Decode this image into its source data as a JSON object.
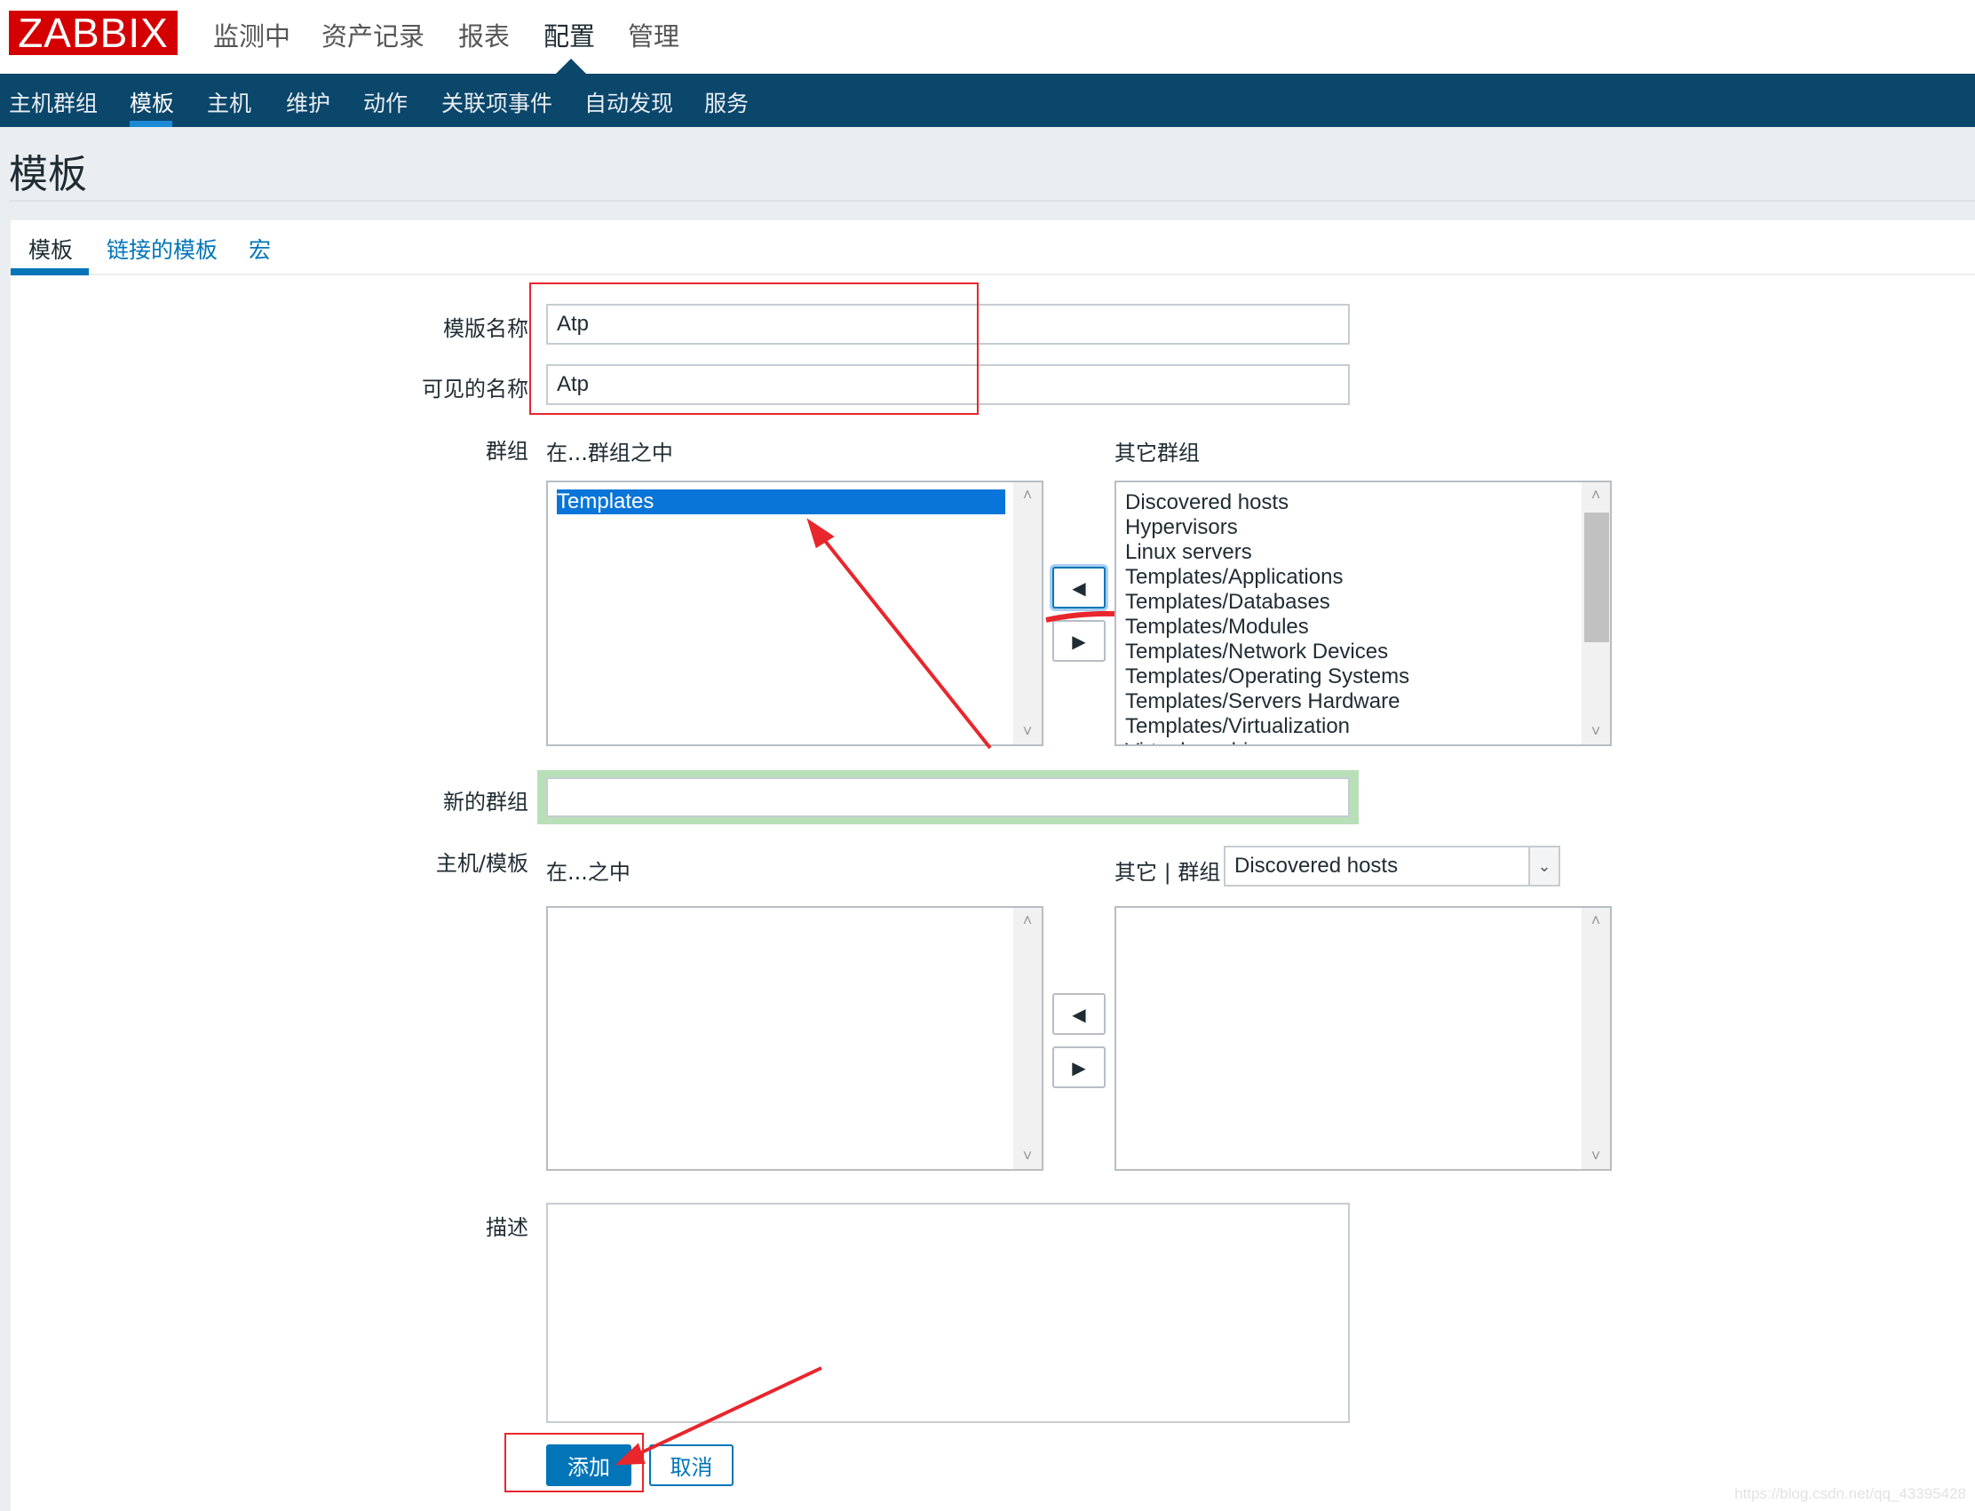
{
  "logo": "ZABBIX",
  "top_menu": [
    "监测中",
    "资产记录",
    "报表",
    "配置",
    "管理"
  ],
  "top_menu_active": "配置",
  "sub_menu": [
    "主机群组",
    "模板",
    "主机",
    "维护",
    "动作",
    "关联项事件",
    "自动发现",
    "服务"
  ],
  "sub_menu_active": "模板",
  "page_title": "模板",
  "tabs": [
    "模板",
    "链接的模板",
    "宏"
  ],
  "form": {
    "template_name_label": "模版名称",
    "template_name_value": "Atp",
    "visible_name_label": "可见的名称",
    "visible_name_value": "Atp",
    "groups_label": "群组",
    "in_groups_label": "在...群组之中",
    "other_groups_label": "其它群组",
    "in_groups": [
      "Templates"
    ],
    "other_groups": [
      "Discovered hosts",
      "Hypervisors",
      "Linux servers",
      "Templates/Applications",
      "Templates/Databases",
      "Templates/Modules",
      "Templates/Network Devices",
      "Templates/Operating Systems",
      "Templates/Servers Hardware",
      "Templates/Virtualization",
      "Virtual machines"
    ],
    "new_group_label": "新的群组",
    "new_group_value": "",
    "hosts_label": "主机/模板",
    "in_label": "在...之中",
    "other_group_label": "其它 | 群组",
    "group_select_value": "Discovered hosts",
    "description_label": "描述",
    "description_value": "",
    "add_button": "添加",
    "cancel_button": "取消"
  },
  "watermark": "https://blog.csdn.net/qq_43395428",
  "colors": {
    "brand": "#d40000",
    "nav": "#0b466b",
    "accent": "#0275b8",
    "annotation": "#e8262c",
    "highlight": "#b9dfb9"
  }
}
